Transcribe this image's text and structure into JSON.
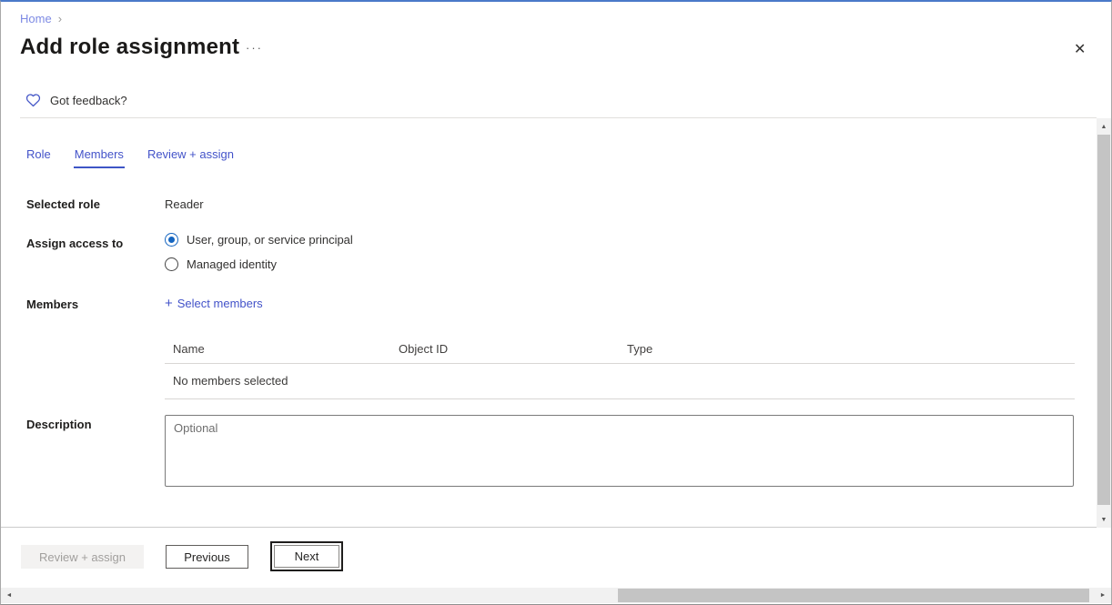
{
  "breadcrumb": {
    "home": "Home"
  },
  "header": {
    "title": "Add role assignment"
  },
  "feedback": {
    "label": "Got feedback?"
  },
  "tabs": [
    {
      "label": "Role",
      "active": false
    },
    {
      "label": "Members",
      "active": true
    },
    {
      "label": "Review + assign",
      "active": false
    }
  ],
  "form": {
    "selected_role": {
      "label": "Selected role",
      "value": "Reader"
    },
    "assign_access_to": {
      "label": "Assign access to",
      "options": [
        {
          "label": "User, group, or service principal",
          "selected": true
        },
        {
          "label": "Managed identity",
          "selected": false
        }
      ]
    },
    "members": {
      "label": "Members",
      "plus": "+",
      "select_action": "Select members"
    },
    "members_table": {
      "headers": [
        "Name",
        "Object ID",
        "Type"
      ],
      "empty_message": "No members selected"
    },
    "description": {
      "label": "Description",
      "placeholder": "Optional"
    }
  },
  "footer": {
    "review_assign_label": "Review + assign",
    "previous_label": "Previous",
    "next_label": "Next"
  },
  "icons": {
    "chevron_right": "›",
    "more": "···",
    "close": "✕",
    "heart": "heart-outline",
    "scroll_up": "▲",
    "scroll_down": "▼",
    "scroll_left": "◄",
    "scroll_right": "►"
  },
  "colors": {
    "accent_link": "#4353c9",
    "tab_underline": "#3e55c6",
    "breadcrumb_link": "#7d8ae4",
    "radio_selected": "#1565c0",
    "top_border": "#4a79c9",
    "disabled_bg": "#f3f2f1",
    "disabled_text": "#a19f9d",
    "scroll_track": "#f1f1f1",
    "scroll_thumb": "#c4c4c4"
  }
}
